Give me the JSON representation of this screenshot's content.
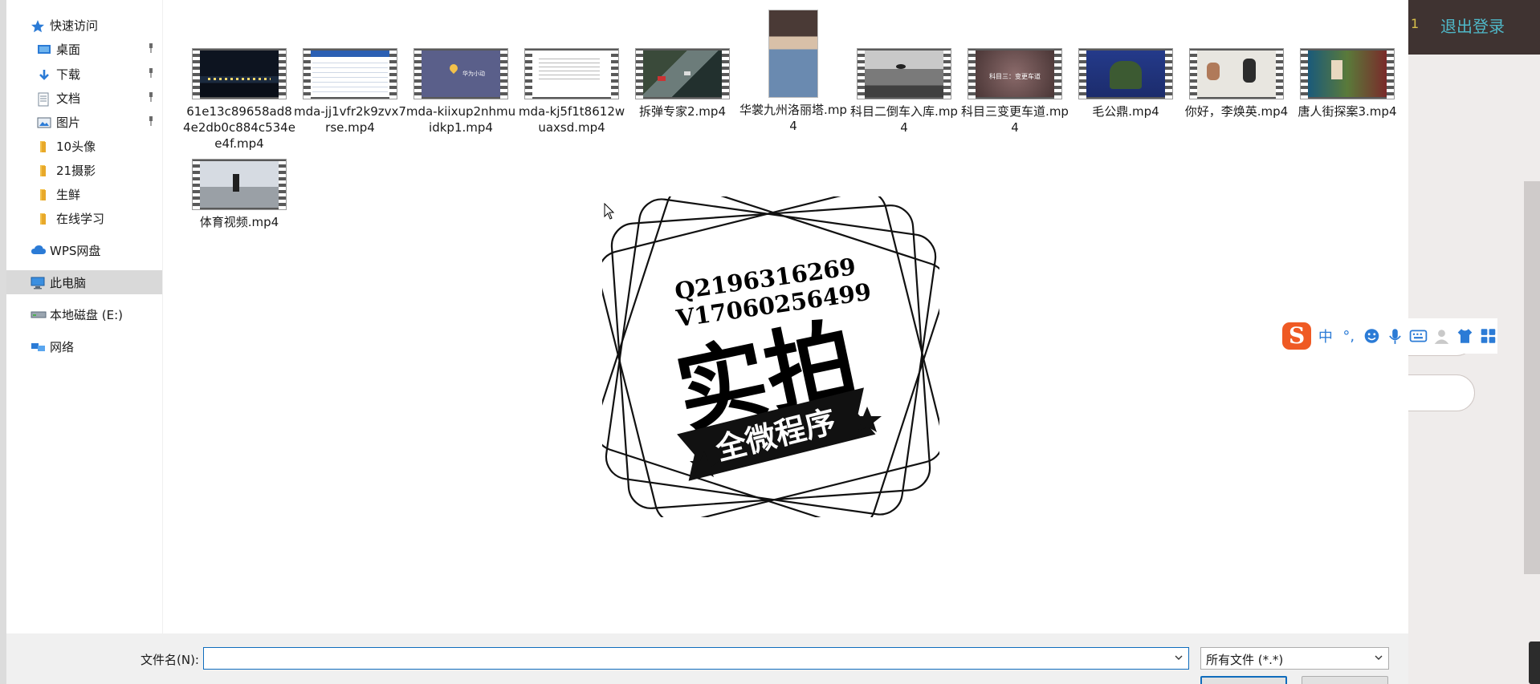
{
  "sidebar": {
    "items": [
      {
        "label": "快速访问",
        "icon": "star-icon"
      },
      {
        "label": "桌面",
        "icon": "desktop-icon",
        "pinned": true
      },
      {
        "label": "下载",
        "icon": "download-icon",
        "pinned": true
      },
      {
        "label": "文档",
        "icon": "document-icon",
        "pinned": true
      },
      {
        "label": "图片",
        "icon": "picture-icon",
        "pinned": true
      },
      {
        "label": "10头像",
        "icon": "folder-icon"
      },
      {
        "label": "21摄影",
        "icon": "folder-icon"
      },
      {
        "label": "生鲜",
        "icon": "folder-icon"
      },
      {
        "label": "在线学习",
        "icon": "folder-icon"
      },
      {
        "label": "WPS网盘",
        "icon": "cloud-icon"
      },
      {
        "label": "此电脑",
        "icon": "computer-icon",
        "selected": true
      },
      {
        "label": "本地磁盘 (E:)",
        "icon": "drive-icon"
      },
      {
        "label": "网络",
        "icon": "network-icon"
      }
    ]
  },
  "files": [
    {
      "name": "61e13c89658ad84e2db0c884c534ee4f.mp4",
      "thumb": "night-city"
    },
    {
      "name": "mda-jj1vfr2k9zvx7rse.mp4",
      "thumb": "spreadsheet"
    },
    {
      "name": "mda-kiixup2nhmuidkp1.mp4",
      "thumb": "map-pin"
    },
    {
      "name": "mda-kj5f1t8612wuaxsd.mp4",
      "thumb": "document"
    },
    {
      "name": "拆弹专家2.mp4",
      "thumb": "street"
    },
    {
      "name": "华裳九州洛丽塔.mp4",
      "thumb": "portrait"
    },
    {
      "name": "科目二倒车入库.mp4",
      "thumb": "car-interior"
    },
    {
      "name": "科目三变更车道.mp4",
      "thumb": "road-title"
    },
    {
      "name": "毛公鼎.mp4",
      "thumb": "bronze"
    },
    {
      "name": "你好，李焕英.mp4",
      "thumb": "people"
    },
    {
      "name": "唐人街探案3.mp4",
      "thumb": "group"
    },
    {
      "name": "体育视频.mp4",
      "thumb": "sport"
    }
  ],
  "thumb_texts": {
    "map_pin": "华为小动",
    "road_title": "科目三：变更车道"
  },
  "watermark": {
    "line1": "Q2196316269",
    "line2": "V17060256499",
    "big": "实拍",
    "banner": "全微程序"
  },
  "bottom": {
    "filename_label": "文件名(N):",
    "filename_value": "",
    "filetype_value": "所有文件 (*.*)"
  },
  "background_app": {
    "number": "1",
    "logout_label": "退出登录"
  },
  "ime": {
    "logo": "S",
    "lang": "中",
    "punct": "°,"
  },
  "colors": {
    "accent": "#0f6cbd",
    "selected_nav": "#d9d9d9",
    "logout": "#4fb8c8",
    "ime_logo": "#ef5a24"
  }
}
